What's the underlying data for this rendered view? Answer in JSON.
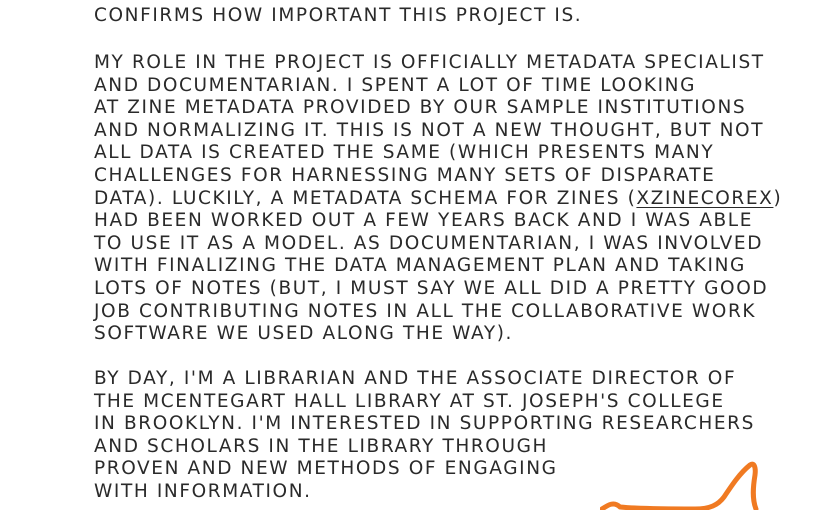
{
  "document": {
    "paragraphs": [
      {
        "lines": [
          "confirms how important this project is."
        ]
      },
      {
        "lines": [
          "My role in the project is officially Metadata Specialist",
          "and Documentarian.  I spent a lot of time looking",
          "at zine metadata provided by our sample institutions",
          "and normalizing it.  This is not a new thought, but not",
          "all data is created the same (which presents many",
          "challenges for harnessing many sets of disparate",
          {
            "before": "data).  Luckily, a metadata schema for zines (",
            "link": "xZineCoreX",
            "after": ")"
          },
          "had been worked out a few years back and I was able",
          "to use it as a model.  As Documentarian, I was involved",
          "with finalizing the data management plan and taking",
          "lots of notes (but, I must say we all did a pretty good",
          "job contributing notes in all the collaborative work",
          "software we used along the way)."
        ]
      },
      {
        "lines": [
          "By day, I'm a librarian and the Associate Director of",
          "the McEntegart Hall Library at St. Joseph's College",
          "in Brooklyn. I'm interested in supporting researchers",
          "and scholars in the library through",
          "proven and new methods of engaging",
          "with information."
        ]
      }
    ]
  },
  "colors": {
    "text": "#2a2a2a",
    "accent_squiggle": "#f07a22",
    "background": "#ffffff"
  }
}
